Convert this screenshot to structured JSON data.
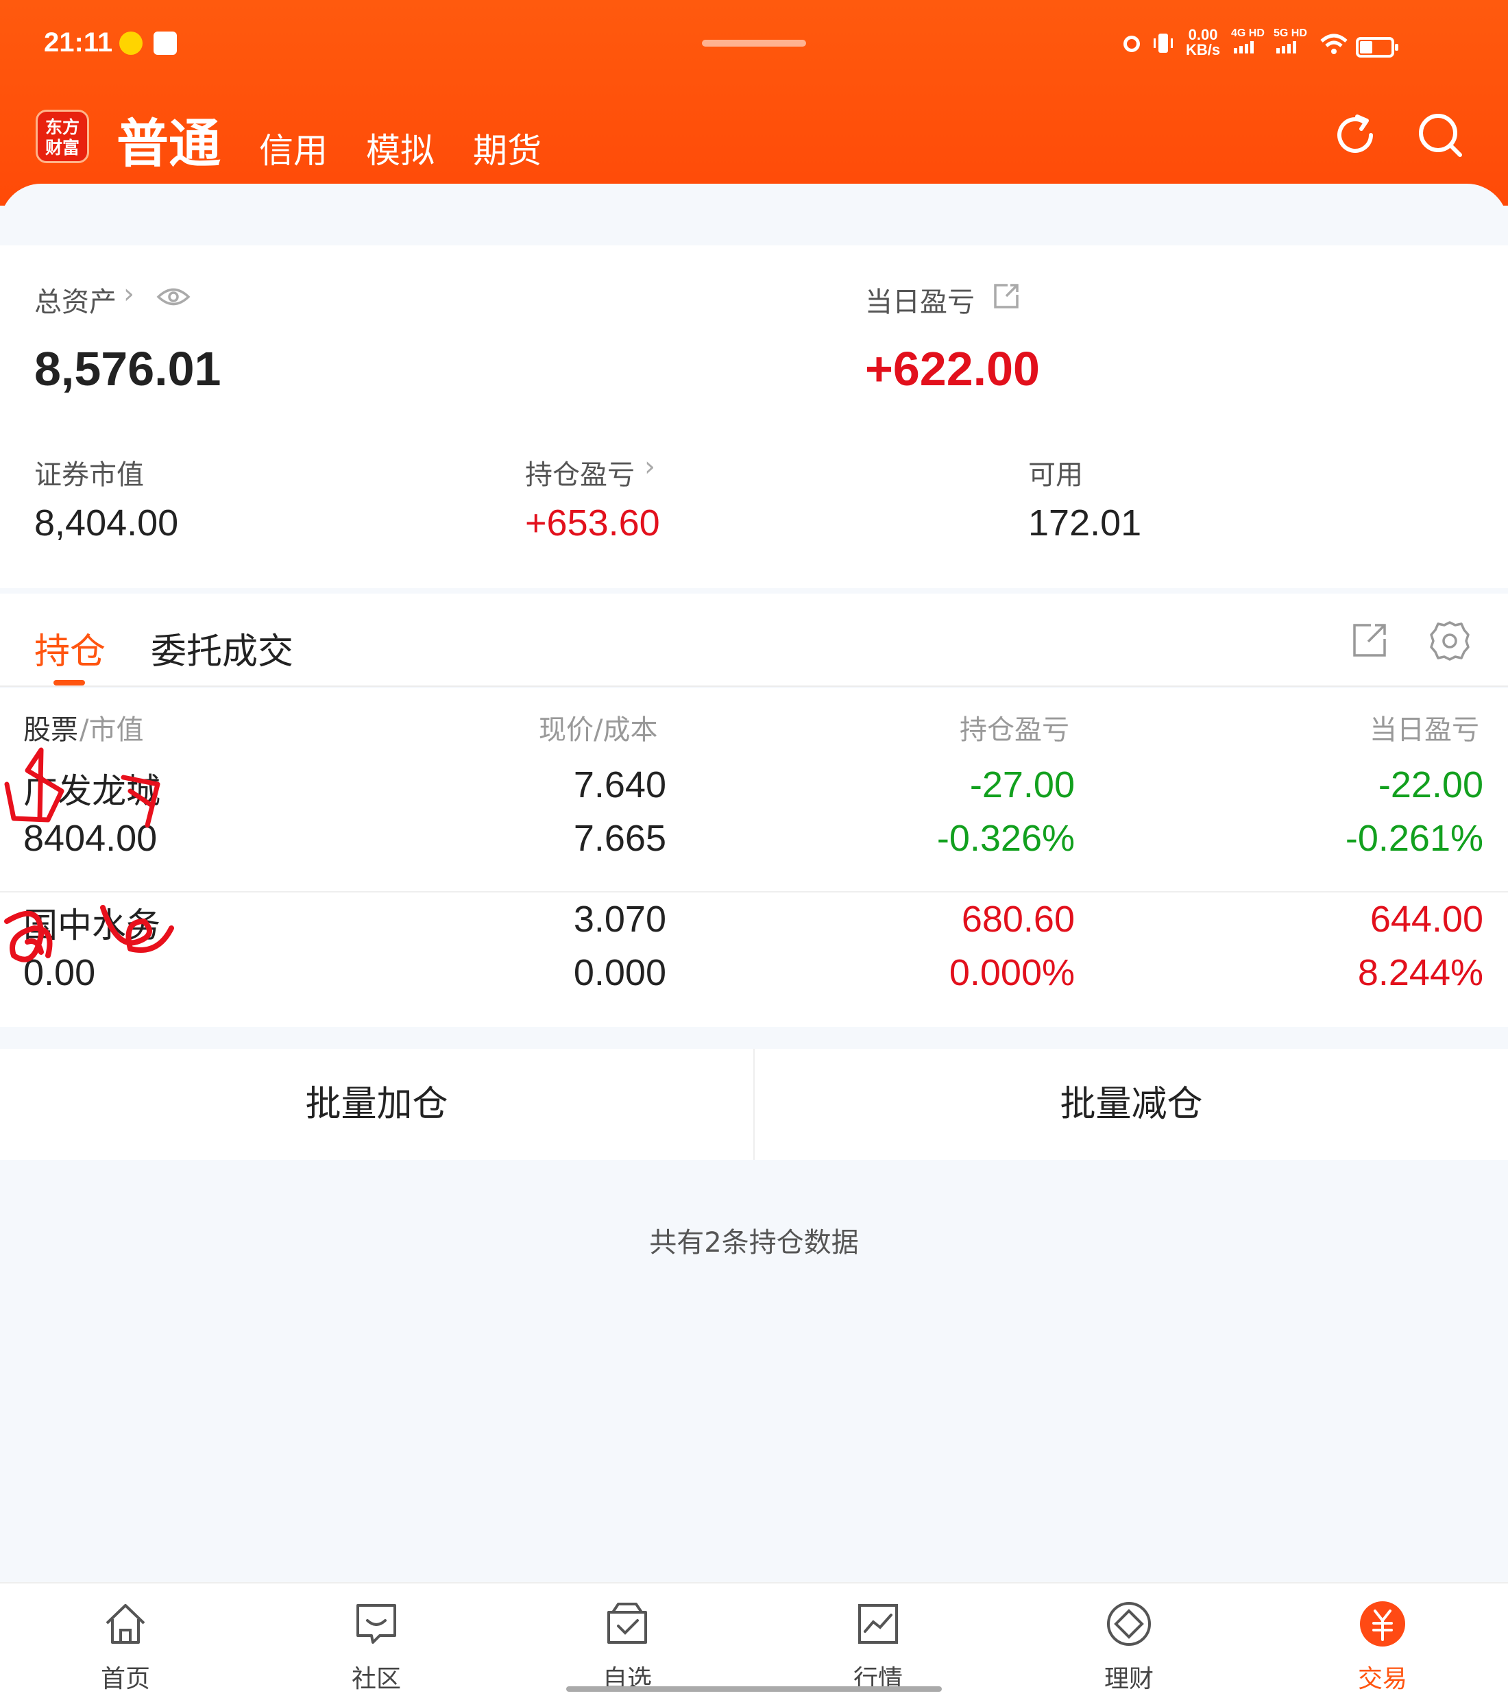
{
  "status_bar": {
    "time": "21:11",
    "net_speed_value": "0.00",
    "net_speed_unit": "KB/s",
    "signal_1": "4G HD",
    "signal_2": "5G HD"
  },
  "header": {
    "logo_text_line1": "东方",
    "logo_text_line2": "财富",
    "tabs": [
      {
        "label": "普通",
        "active": true
      },
      {
        "label": "信用",
        "active": false
      },
      {
        "label": "模拟",
        "active": false
      },
      {
        "label": "期货",
        "active": false
      }
    ],
    "icons": [
      "refresh-icon",
      "search-icon"
    ]
  },
  "summary": {
    "total_assets_label": "总资产",
    "total_assets_value": "8,576.01",
    "daily_pl_label": "当日盈亏",
    "daily_pl_value": "+622.00",
    "market_value_label": "证券市值",
    "market_value_value": "8,404.00",
    "position_pl_label": "持仓盈亏",
    "position_pl_value": "+653.60",
    "available_label": "可用",
    "available_value": "172.01"
  },
  "tabs": {
    "positions": "持仓",
    "orders": "委托成交"
  },
  "table": {
    "headers": {
      "stock_a": "股票",
      "stock_b": "/市值",
      "price": "现价/成本",
      "position_pl": "持仓盈亏",
      "daily_pl": "当日盈亏"
    },
    "rows": [
      {
        "name": "广发龙城",
        "market_value": "8404.00",
        "price": "7.640",
        "cost": "7.665",
        "position_pl": "-27.00",
        "position_pl_pct": "-0.326%",
        "daily_pl": "-22.00",
        "daily_pl_pct": "-0.261%",
        "trend": "down"
      },
      {
        "name": "国中水务",
        "market_value": "0.00",
        "price": "3.070",
        "cost": "0.000",
        "position_pl": "680.60",
        "position_pl_pct": "0.000%",
        "daily_pl": "644.00",
        "daily_pl_pct": "8.244%",
        "trend": "up"
      }
    ]
  },
  "actions": {
    "batch_add": "批量加仓",
    "batch_reduce": "批量减仓"
  },
  "count_note": "共有2条持仓数据",
  "bottom_nav": [
    {
      "label": "首页",
      "icon": "home-icon"
    },
    {
      "label": "社区",
      "icon": "chat-icon"
    },
    {
      "label": "自选",
      "icon": "watchlist-icon"
    },
    {
      "label": "行情",
      "icon": "chart-icon"
    },
    {
      "label": "理财",
      "icon": "finance-icon"
    },
    {
      "label": "交易",
      "icon": "yuan-icon",
      "active": true
    }
  ],
  "colors": {
    "brand": "#ff5510",
    "up": "#e2101c",
    "down": "#12a01e"
  }
}
